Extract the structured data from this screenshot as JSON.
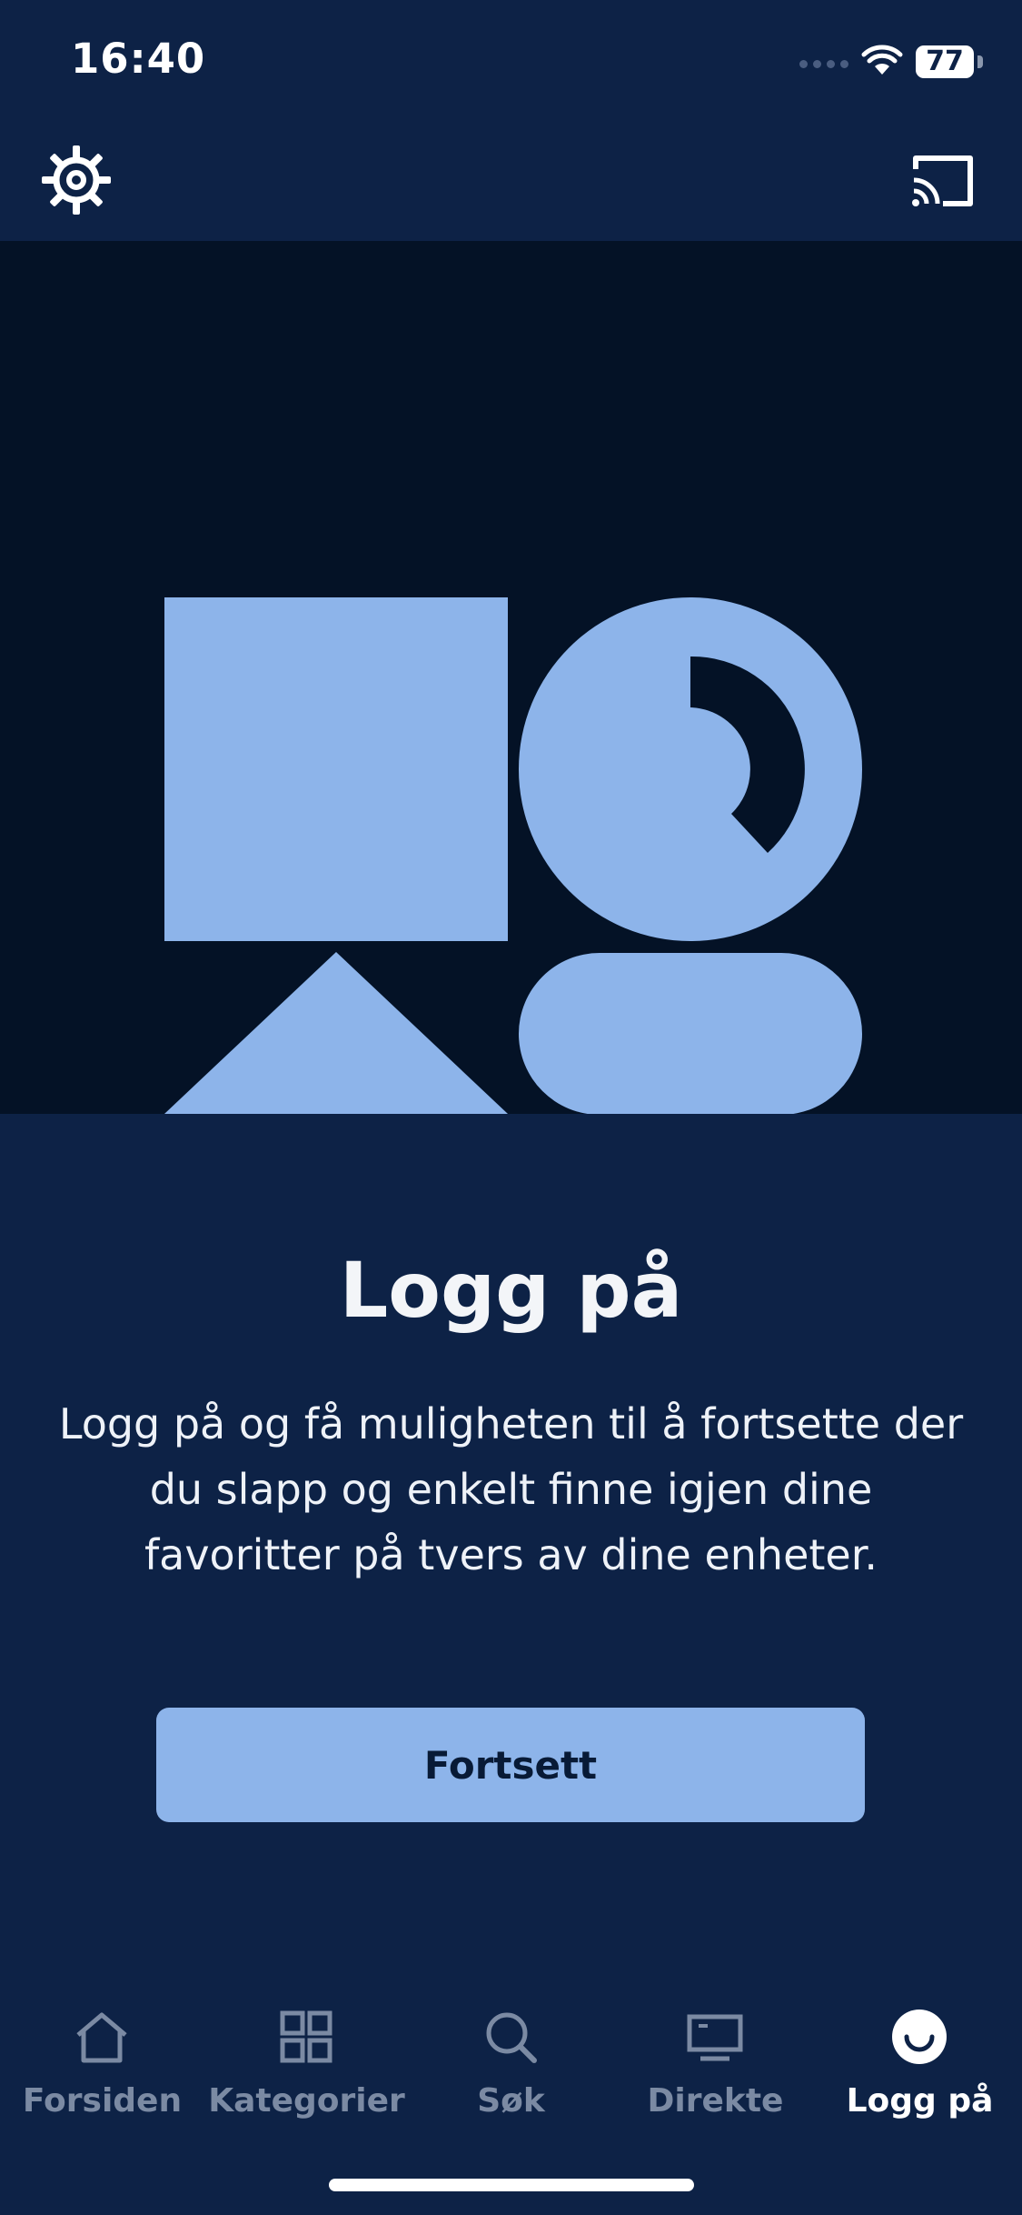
{
  "status": {
    "time": "16:40",
    "battery": "77"
  },
  "colors": {
    "background": "#0d2246",
    "hero_bg": "#041226",
    "accent": "#8db4ea",
    "muted": "#7b8aa3"
  },
  "header": {
    "left_icon": "gear-icon",
    "right_icon": "cast-icon"
  },
  "main": {
    "title": "Logg på",
    "description": "Logg på og få muligheten til å fortsette der du slapp og enkelt finne igjen dine favoritter på tvers av dine enheter.",
    "button_label": "Fortsett"
  },
  "tabs": [
    {
      "label": "Forsiden",
      "icon": "home-icon",
      "active": false
    },
    {
      "label": "Kategorier",
      "icon": "grid-icon",
      "active": false
    },
    {
      "label": "Søk",
      "icon": "search-icon",
      "active": false
    },
    {
      "label": "Direkte",
      "icon": "tv-icon",
      "active": false
    },
    {
      "label": "Logg på",
      "icon": "user-smile-icon",
      "active": true
    }
  ]
}
